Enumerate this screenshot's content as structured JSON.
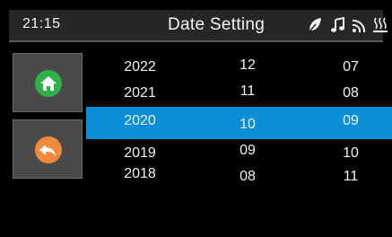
{
  "header": {
    "time": "21:15",
    "title": "Date Setting",
    "status_icons": [
      "leaf-icon",
      "music-note-icon",
      "wifi-icon",
      "heating-icon"
    ]
  },
  "side_buttons": {
    "home_icon": "home-icon",
    "back_icon": "back-arrow-icon",
    "home_color": "#2fb24a",
    "back_color": "#f08a3c"
  },
  "accent_color": "#0c8fd9",
  "rows": [
    {
      "year": "2022",
      "month": "12",
      "day": "07"
    },
    {
      "year": "2021",
      "month": "11",
      "day": "08"
    },
    {
      "year": "2020",
      "month": "10",
      "day": "09",
      "selected": true
    },
    {
      "year": "2019",
      "month": "09",
      "day": "10"
    },
    {
      "year": "2018",
      "month": "08",
      "day": "11"
    }
  ]
}
